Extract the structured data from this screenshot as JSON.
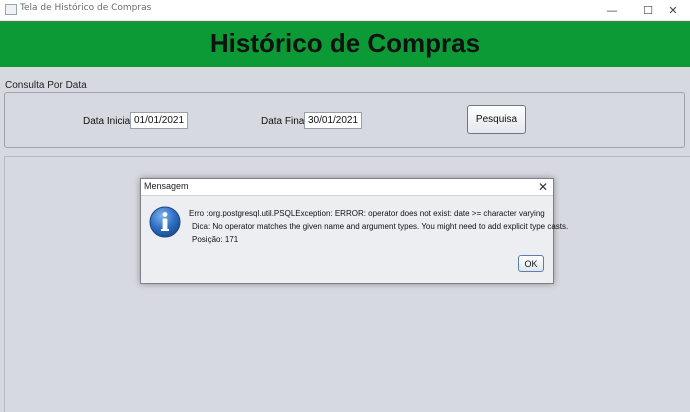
{
  "window": {
    "title": "Tela de Histórico de Compras",
    "minimize_icon": "—",
    "maximize_icon": "☐",
    "close_icon": "✕"
  },
  "header": {
    "title": "Histórico de Compras",
    "background_color": "#0b9a36"
  },
  "search_panel": {
    "group_label": "Consulta Por Data",
    "start_label": "Data Inicial:",
    "start_value": "01/01/2021",
    "end_label": "Data Final:",
    "end_value": "30/01/2021",
    "search_button": "Pesquisa"
  },
  "dialog": {
    "title": "Mensagem",
    "close_icon": "✕",
    "icon": "info-icon",
    "lines": [
      "Erro :org.postgresql.util.PSQLException: ERROR: operator does not exist: date >= character varying",
      "Dica: No operator matches the given name and argument types. You might need to add explicit type casts.",
      "Posição: 171"
    ],
    "ok_button": "OK"
  }
}
